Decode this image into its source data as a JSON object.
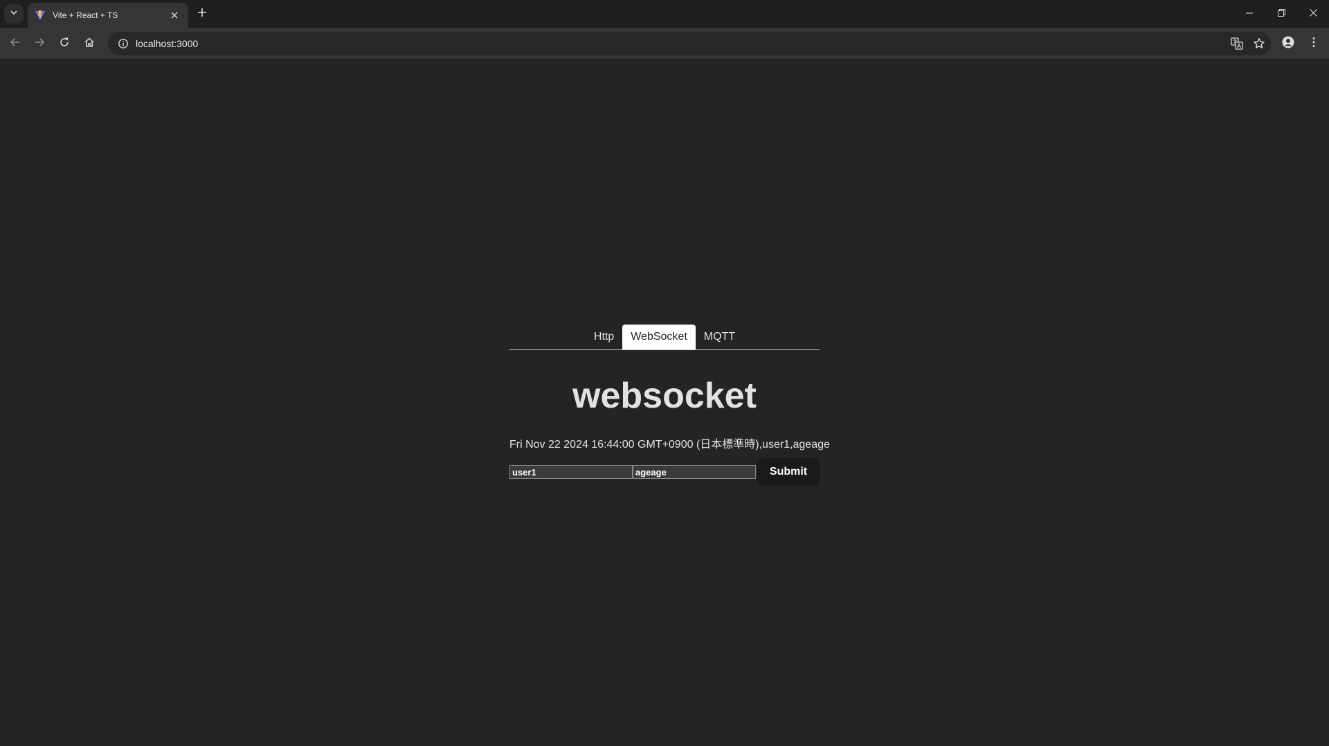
{
  "browser": {
    "tab_title": "Vite + React + TS",
    "url": "localhost:3000"
  },
  "icons": {
    "tab_search": "chevron-down-icon",
    "favicon": "vite-logo-icon",
    "tab_close": "close-icon",
    "new_tab": "plus-icon",
    "back": "arrow-left-icon",
    "forward": "arrow-right-icon",
    "reload": "reload-icon",
    "home": "home-icon",
    "site_info": "info-icon",
    "translate": "translate-icon",
    "bookmark": "star-icon",
    "profile": "person-icon",
    "menu": "kebab-menu-icon",
    "minimize": "minimize-icon",
    "restore": "restore-icon",
    "close_window": "close-icon"
  },
  "page": {
    "tabs": [
      {
        "label": "Http",
        "active": false
      },
      {
        "label": "WebSocket",
        "active": true
      },
      {
        "label": "MQTT",
        "active": false
      }
    ],
    "heading": "websocket",
    "message": "Fri Nov 22 2024 16:44:00 GMT+0900 (日本標準時),user1,ageage",
    "form": {
      "name_value": "user1",
      "text_value": "ageage",
      "submit_label": "Submit"
    }
  },
  "colors": {
    "page_background": "#242424",
    "active_tab_background": "#ffffff",
    "button_background": "#1a1a1a"
  }
}
